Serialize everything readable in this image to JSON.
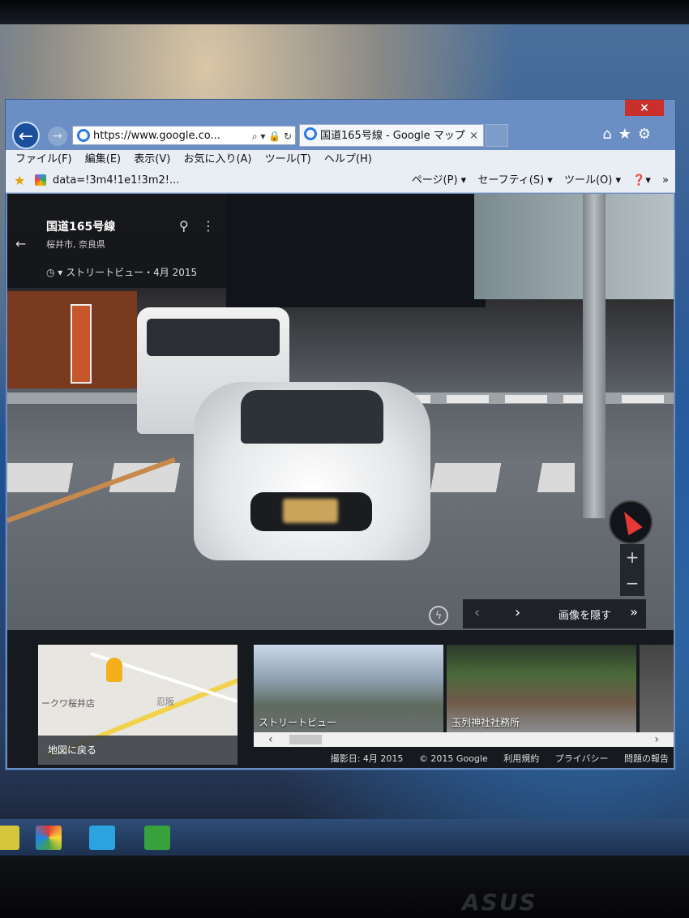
{
  "browser": {
    "close_label": "×",
    "back_label": "←",
    "forward_label": "→",
    "address": "https://www.google.co...",
    "address_tools": "⌕ ▾ 🔒 ↻",
    "tab_title": "国道165号線 - Google マップ",
    "tab_close": "×",
    "nav_icons": "⌂★⚙",
    "menu": [
      "ファイル(F)",
      "編集(E)",
      "表示(V)",
      "お気に入り(A)",
      "ツール(T)",
      "ヘルプ(H)"
    ],
    "fav_link": "data=!3m4!1e1!3m2!...",
    "command_bar": [
      "ページ(P) ▾",
      "セーフティ(S) ▾",
      "ツール(O) ▾",
      "❓▾",
      "»"
    ]
  },
  "info_card": {
    "back": "←",
    "title": "国道165号線",
    "subtitle": "桜井市, 奈良県",
    "pin": "⚲",
    "more": "⋮",
    "date": "◷ ▾  ストリートビュー・4月 2015"
  },
  "controls": {
    "zoom_in": "+",
    "zoom_out": "−",
    "lightning": "ϟ",
    "prev": "‹",
    "next": "›",
    "hide_images": "画像を隠す",
    "collapse": "»"
  },
  "strip": {
    "minimap_label1": "ークワ桜井店",
    "minimap_label2": "忍阪",
    "back_to_map": "地図に戻る",
    "thumbs": [
      "ストリートビュー",
      "玉列神社社務所",
      ""
    ],
    "scroll_left": "‹",
    "scroll_right": "›",
    "footer": [
      "撮影日: 4月 2015",
      "© 2015 Google",
      "利用規約",
      "プライバシー",
      "問題の報告"
    ]
  },
  "desktop": {
    "logo": "ASUS"
  }
}
